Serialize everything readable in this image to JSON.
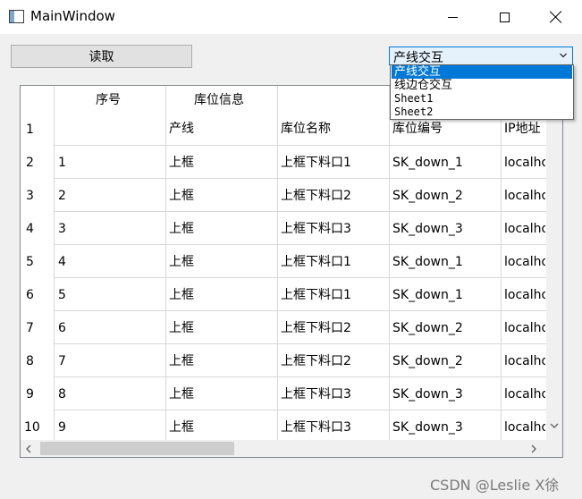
{
  "window": {
    "title": "MainWindow",
    "icon": "app-window-icon",
    "controls": [
      "minimize-icon",
      "maximize-icon",
      "close-icon"
    ]
  },
  "toolbar": {
    "read_label": "读取"
  },
  "sheet_combo": {
    "value": "产线交互",
    "options": [
      "产线交互",
      "线边仓交互",
      "Sheet1",
      "Sheet2"
    ],
    "selected_index": 0,
    "accent": "#0078d7"
  },
  "table": {
    "header_row": [
      "序号",
      "库位信息",
      "",
      "",
      ""
    ],
    "sub_header_row": [
      "",
      "产线",
      "库位名称",
      "库位编号",
      "IP地址"
    ],
    "row_numbers": [
      "1",
      "2",
      "3",
      "4",
      "5",
      "6",
      "7",
      "8",
      "9",
      "10"
    ],
    "rows": [
      [
        "1",
        "上框",
        "上框下料口1",
        "SK_down_1",
        "localhost"
      ],
      [
        "2",
        "上框",
        "上框下料口2",
        "SK_down_2",
        "localhost"
      ],
      [
        "3",
        "上框",
        "上框下料口3",
        "SK_down_3",
        "localhost"
      ],
      [
        "4",
        "上框",
        "上框下料口1",
        "SK_down_1",
        "localhost"
      ],
      [
        "5",
        "上框",
        "上框下料口1",
        "SK_down_1",
        "localhost"
      ],
      [
        "6",
        "上框",
        "上框下料口2",
        "SK_down_2",
        "localhost"
      ],
      [
        "7",
        "上框",
        "上框下料口2",
        "SK_down_2",
        "localhost"
      ],
      [
        "8",
        "上框",
        "上框下料口3",
        "SK_down_3",
        "localhost"
      ],
      [
        "9",
        "上框",
        "上框下料口3",
        "SK_down_3",
        "localhost"
      ]
    ]
  },
  "watermark": "CSDN @Leslie X徐"
}
